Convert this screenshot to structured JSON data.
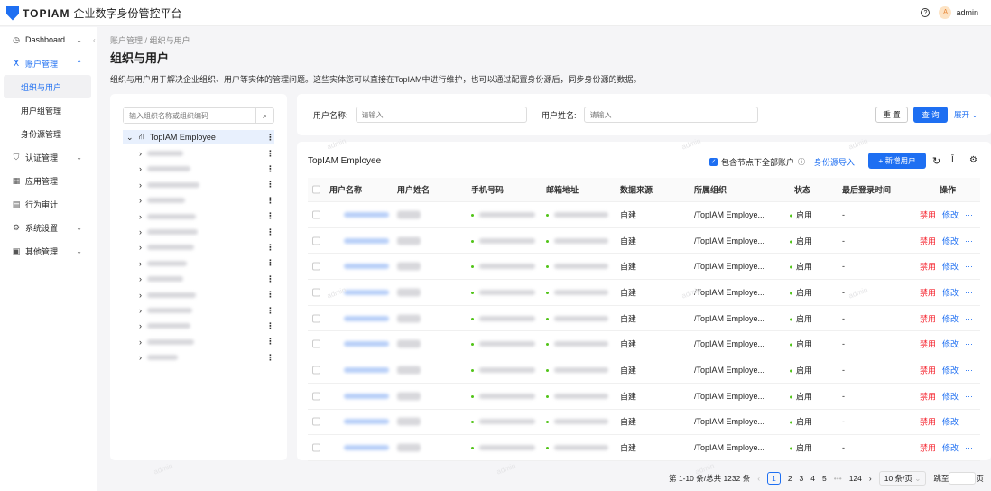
{
  "header": {
    "brand": "TOPIAM",
    "product": "企业数字身份管控平台",
    "help_icon": "question-circle-icon",
    "user_initial": "A",
    "user_name": "admin"
  },
  "sidebar": {
    "items": [
      {
        "label": "Dashboard",
        "icon": "dashboard-icon",
        "chevron": "⌄"
      },
      {
        "label": "账户管理",
        "icon": "user-icon",
        "chevron": "⌃",
        "expanded": true,
        "children": [
          {
            "label": "组织与用户",
            "selected": true
          },
          {
            "label": "用户组管理"
          },
          {
            "label": "身份源管理"
          }
        ]
      },
      {
        "label": "认证管理",
        "icon": "shield-icon",
        "chevron": "⌄"
      },
      {
        "label": "应用管理",
        "icon": "apps-icon"
      },
      {
        "label": "行为审计",
        "icon": "audit-icon"
      },
      {
        "label": "系统设置",
        "icon": "gear-icon",
        "chevron": "⌄"
      },
      {
        "label": "其他管理",
        "icon": "other-icon",
        "chevron": "⌄"
      }
    ]
  },
  "breadcrumb": [
    "账户管理",
    "/",
    "组织与用户"
  ],
  "page": {
    "title": "组织与用户",
    "description": "组织与用户用于解决企业组织、用户等实体的管理问题。这些实体您可以直接在TopIAM中进行维护，也可以通过配置身份源后，同步身份源的数据。"
  },
  "tree": {
    "search_placeholder": "输入组织名称或组织编码",
    "root": "TopIAM Employee",
    "child_count": 14
  },
  "filter": {
    "username_label": "用户名称:",
    "username_placeholder": "请输入",
    "fullname_label": "用户姓名:",
    "fullname_placeholder": "请输入",
    "reset": "重 置",
    "query": "查 询",
    "expand": "展开"
  },
  "table": {
    "title": "TopIAM Employee",
    "include_sub": "包含节点下全部账户",
    "include_sub_checked": true,
    "import": "身份源导入",
    "add": "新增用户",
    "columns": [
      "用户名称",
      "用户姓名",
      "手机号码",
      "邮箱地址",
      "数据来源",
      "所属组织",
      "状态",
      "最后登录时间",
      "操作"
    ],
    "rows": [
      {
        "source": "自建",
        "org": "/TopIAM Employe...",
        "status": "启用",
        "last_login": "-"
      },
      {
        "source": "自建",
        "org": "/TopIAM Employe...",
        "status": "启用",
        "last_login": "-"
      },
      {
        "source": "自建",
        "org": "/TopIAM Employe...",
        "status": "启用",
        "last_login": "-"
      },
      {
        "source": "自建",
        "org": "/TopIAM Employe...",
        "status": "启用",
        "last_login": "-"
      },
      {
        "source": "自建",
        "org": "/TopIAM Employe...",
        "status": "启用",
        "last_login": "-"
      },
      {
        "source": "自建",
        "org": "/TopIAM Employe...",
        "status": "启用",
        "last_login": "-"
      },
      {
        "source": "自建",
        "org": "/TopIAM Employe...",
        "status": "启用",
        "last_login": "-"
      },
      {
        "source": "自建",
        "org": "/TopIAM Employe...",
        "status": "启用",
        "last_login": "-"
      },
      {
        "source": "自建",
        "org": "/TopIAM Employe...",
        "status": "启用",
        "last_login": "-"
      },
      {
        "source": "自建",
        "org": "/TopIAM Employe...",
        "status": "启用",
        "last_login": "-"
      }
    ],
    "actions": {
      "disable": "禁用",
      "edit": "修改",
      "more": "···"
    }
  },
  "pagination": {
    "summary": "第 1-10 条/总共 1232 条",
    "pages": [
      "1",
      "2",
      "3",
      "4",
      "5",
      "•••",
      "124"
    ],
    "current": "1",
    "page_size": "10 条/页",
    "jump_label": "跳至",
    "jump_suffix": "页"
  },
  "watermark": "admin",
  "colors": {
    "primary": "#1e6ff2",
    "danger": "#f5222d",
    "success": "#52c41a"
  }
}
